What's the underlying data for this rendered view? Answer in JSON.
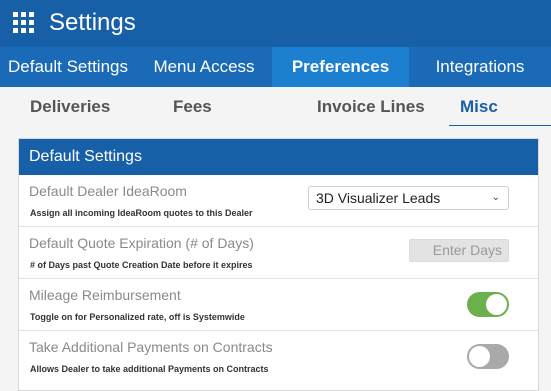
{
  "header": {
    "title": "Settings",
    "menu_icon": "grid-icon"
  },
  "tabs": [
    {
      "label": "Default Settings",
      "active": false
    },
    {
      "label": "Menu Access",
      "active": false
    },
    {
      "label": "Preferences",
      "active": true
    },
    {
      "label": "Integrations",
      "active": false
    }
  ],
  "subtabs": [
    {
      "label": "Deliveries",
      "active": false
    },
    {
      "label": "Fees",
      "active": false
    },
    {
      "label": "Invoice Lines",
      "active": false
    },
    {
      "label": "Misc",
      "active": true
    }
  ],
  "panel": {
    "title": "Default Settings",
    "rows": [
      {
        "label": "Default Dealer IdeaRoom",
        "description": "Assign all incoming IdeaRoom quotes to this Dealer",
        "control": "select",
        "value": "3D Visualizer Leads"
      },
      {
        "label": "Default Quote Expiration (# of Days)",
        "description": "# of Days past Quote Creation Date before it expires",
        "control": "input",
        "value": "",
        "placeholder": "Enter Days"
      },
      {
        "label": "Mileage Reimbursement",
        "description": "Toggle on for Personalized rate, off is Systemwide",
        "control": "toggle",
        "on": true
      },
      {
        "label": "Take Additional Payments on Contracts",
        "description": "Allows Dealer to take additional Payments on Contracts",
        "control": "toggle",
        "on": false
      }
    ]
  },
  "colors": {
    "header_bg": "#1760a8",
    "tab_bg": "#1a6ab7",
    "tab_active_bg": "#1d7fd0",
    "toggle_on": "#6ab04c",
    "toggle_off": "#a9a9a9",
    "subtab_active": "#1a5fa5"
  }
}
